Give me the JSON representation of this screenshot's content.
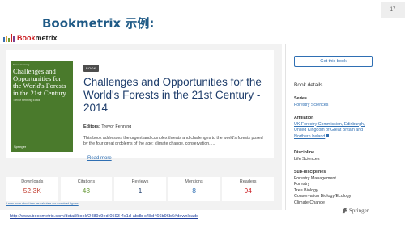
{
  "slide": {
    "title": "Bookmetrix 示例:",
    "page_number": "17"
  },
  "header": {
    "logo_text_a": "Book",
    "logo_text_b": "metrix",
    "logo_bar_colors": [
      "#3b6fb0",
      "#e1a23a",
      "#6a9b3b",
      "#cc1f24",
      "#7a3e8f"
    ]
  },
  "book": {
    "cover": {
      "top_text": "Trevor Fenning",
      "title": "Challenges and Opportunities for the World's Forests in the 21st Century",
      "editor": "Trevor Fenning Editor",
      "publisher": "Springer"
    },
    "badge": "BOOK",
    "title": "Challenges and Opportunities for the World's Forests in the 21st Century - 2014",
    "editors_label": "Editors:",
    "editors_value": "Trevor Fenning",
    "description": "This book addresses the urgent and complex threats and challenges to the world's forests posed by the four great problems of the age: climate change, conservation, ...",
    "read_more": "Read more"
  },
  "stats": [
    {
      "label": "Downloads",
      "value": "52.3K",
      "color": "#c0392b"
    },
    {
      "label": "Citations",
      "value": "43",
      "color": "#6a9b3b"
    },
    {
      "label": "Reviews",
      "value": "1",
      "color": "#1e3d6b"
    },
    {
      "label": "Mentions",
      "value": "8",
      "color": "#2f6fb3"
    },
    {
      "label": "Readers",
      "value": "94",
      "color": "#cc1f24"
    }
  ],
  "learn_link": "Learn more about how we calculate our download figures",
  "sidebar": {
    "get_button": "Get this book",
    "details_heading": "Book details",
    "series_label": "Series",
    "series_value": "Forestry Sciences",
    "affiliation_label": "Affiliation",
    "affiliation_value": "UK Forestry Commission, Edinburgh, United Kingdom of Great Britain and Northern Ireland",
    "discipline_label": "Discipline",
    "discipline_value": "Life Sciences",
    "subdisciplines_label": "Sub-disciplines",
    "subdisciplines": [
      "Forestry Management",
      "Forestry",
      "Tree Biology",
      "Conservation Biology/Ecology",
      "Climate Change"
    ]
  },
  "springer_label": "Springer",
  "url": "http://www.bookmetrix.com/detail/book/2489c9ed-0593-4c1d-abdb-c48d466b96b6#downloads"
}
